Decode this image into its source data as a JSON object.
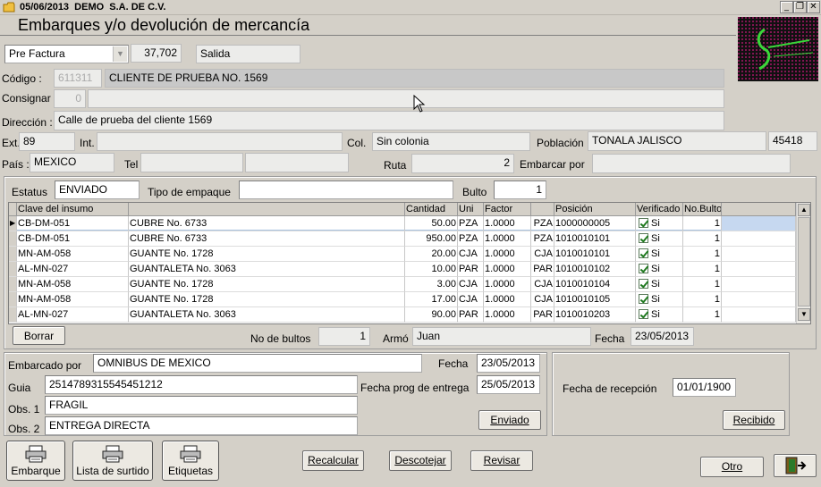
{
  "window": {
    "title": "05/06/2013  DEMO  S.A. DE C.V.",
    "heading": "Embarques y/o devolución de mercancía",
    "min_btn": "_",
    "restore_btn": "❐",
    "close_btn": "✕"
  },
  "header": {
    "doc_type": "Pre Factura",
    "doc_number": "37,702",
    "movement": "Salida"
  },
  "client": {
    "codigo_label": "Código :",
    "codigo_value": "611311",
    "name": "CLIENTE DE PRUEBA NO. 1569",
    "consignar_label": "Consignar",
    "consignar_value": "0",
    "consignar_name": "",
    "direccion_label": "Dirección :",
    "direccion_value": "Calle de prueba del cliente 1569",
    "ext_label": "Ext.",
    "ext_value": "89",
    "int_label": "Int.",
    "int_value": "",
    "col_label": "Col.",
    "col_value": "Sin colonia",
    "poblacion_label": "Población",
    "poblacion_value": "TONALA JALISCO",
    "cp_value": "45418",
    "pais_label": "País :",
    "pais_value": "MEXICO",
    "tel_label": "Tel",
    "tel_value1": "",
    "tel_value2": "",
    "ruta_label": "Ruta",
    "ruta_value": "2",
    "embarcar_label": "Embarcar por",
    "embarcar_value": ""
  },
  "status": {
    "estatus_label": "Estatus",
    "estatus_value": "ENVIADO",
    "empaque_label": "Tipo de empaque",
    "empaque_value": "",
    "bulto_label": "Bulto",
    "bulto_value": "1"
  },
  "grid": {
    "columns": [
      "Clave del insumo",
      "",
      "Cantidad",
      "Uni",
      "Factor",
      "",
      "Posición",
      "Verificado",
      "No.Bulto"
    ],
    "rows": [
      {
        "clave": "CB-DM-051",
        "desc": "CUBRE No. 6733",
        "cantidad": "50.00",
        "uni": "PZA",
        "factor": "1.0000",
        "uni2": "PZA",
        "posicion": "1000000005",
        "verificado": "Si",
        "bulto": "1"
      },
      {
        "clave": "CB-DM-051",
        "desc": "CUBRE No. 6733",
        "cantidad": "950.00",
        "uni": "PZA",
        "factor": "1.0000",
        "uni2": "PZA",
        "posicion": "1010010101",
        "verificado": "Si",
        "bulto": "1"
      },
      {
        "clave": "MN-AM-058",
        "desc": "GUANTE No. 1728",
        "cantidad": "20.00",
        "uni": "CJA",
        "factor": "1.0000",
        "uni2": "CJA",
        "posicion": "1010010101",
        "verificado": "Si",
        "bulto": "1"
      },
      {
        "clave": "AL-MN-027",
        "desc": "GUANTALETA No. 3063",
        "cantidad": "10.00",
        "uni": "PAR",
        "factor": "1.0000",
        "uni2": "PAR",
        "posicion": "1010010102",
        "verificado": "Si",
        "bulto": "1"
      },
      {
        "clave": "MN-AM-058",
        "desc": "GUANTE No. 1728",
        "cantidad": "3.00",
        "uni": "CJA",
        "factor": "1.0000",
        "uni2": "CJA",
        "posicion": "1010010104",
        "verificado": "Si",
        "bulto": "1"
      },
      {
        "clave": "MN-AM-058",
        "desc": "GUANTE No. 1728",
        "cantidad": "17.00",
        "uni": "CJA",
        "factor": "1.0000",
        "uni2": "CJA",
        "posicion": "1010010105",
        "verificado": "Si",
        "bulto": "1"
      },
      {
        "clave": "AL-MN-027",
        "desc": "GUANTALETA No. 3063",
        "cantidad": "90.00",
        "uni": "PAR",
        "factor": "1.0000",
        "uni2": "PAR",
        "posicion": "1010010203",
        "verificado": "Si",
        "bulto": "1"
      }
    ]
  },
  "summary": {
    "borrar_label": "Borrar",
    "bultos_label": "No de bultos",
    "bultos_value": "1",
    "armo_label": "Armó",
    "armo_value": "Juan",
    "fecha_label": "Fecha",
    "fecha_value": "23/05/2013"
  },
  "shipping": {
    "embarcado_label": "Embarcado por",
    "embarcado_value": "OMNIBUS DE MEXICO",
    "fecha_label": "Fecha",
    "fecha_value": "23/05/2013",
    "guia_label": "Guia",
    "guia_value": "2514789315545451212",
    "fecha_prog_label": "Fecha prog de entrega",
    "fecha_prog_value": "25/05/2013",
    "obs1_label": "Obs. 1",
    "obs1_value": "FRAGIL",
    "obs2_label": "Obs. 2",
    "obs2_value": "ENTREGA DIRECTA",
    "enviado_btn": "Enviado"
  },
  "reception": {
    "fecha_label": "Fecha de recepción",
    "fecha_value": "01/01/1900",
    "recibido_btn": "Recibido"
  },
  "toolbar": {
    "embarque": "Embarque",
    "surtido": "Lista de surtido",
    "etiquetas": "Etiquetas",
    "recalcular": "Recalcular",
    "descotejar": "Descotejar",
    "revisar": "Revisar",
    "otro": "Otro"
  },
  "icons": [
    "folder-icon",
    "printer-icon",
    "exit-door-icon",
    "logo-image",
    "checkbox-icon"
  ]
}
